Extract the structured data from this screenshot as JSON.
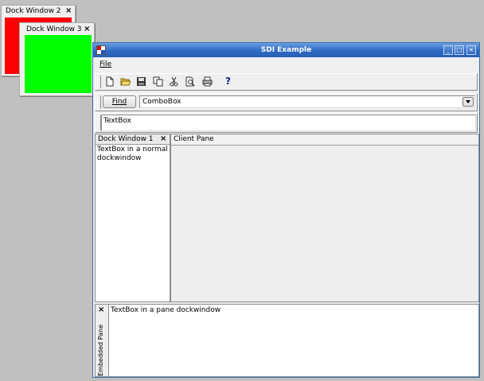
{
  "dock2": {
    "title": "Dock Window 2",
    "close": "×",
    "color": "#ff0000"
  },
  "dock3": {
    "title": "Dock Window 3",
    "close": "×",
    "color": "#00ff00"
  },
  "main": {
    "title": "SDI Example",
    "controls": {
      "minimize": "_",
      "maximize": "□",
      "close": "×"
    },
    "menu": {
      "file": "File"
    },
    "toolbar": {
      "icons": [
        "new-file-icon",
        "open-folder-icon",
        "save-icon",
        "copy-icon",
        "cut-icon",
        "print-preview-icon",
        "print-icon",
        "help-icon"
      ],
      "help_glyph": "?"
    },
    "find_label": "Find",
    "combo_value": "ComboBox",
    "textbox_value": "TextBox",
    "dock1": {
      "title": "Dock Window 1",
      "close": "×",
      "text": "TextBox in a normal dockwindow"
    },
    "client": {
      "header": "Client Pane"
    },
    "embedded": {
      "title": "Embedded Pane",
      "close": "×",
      "text": "TextBox in a pane dockwindow"
    }
  },
  "colors": {
    "titlebar": "#2d69c4",
    "background": "#c0c0c0"
  }
}
